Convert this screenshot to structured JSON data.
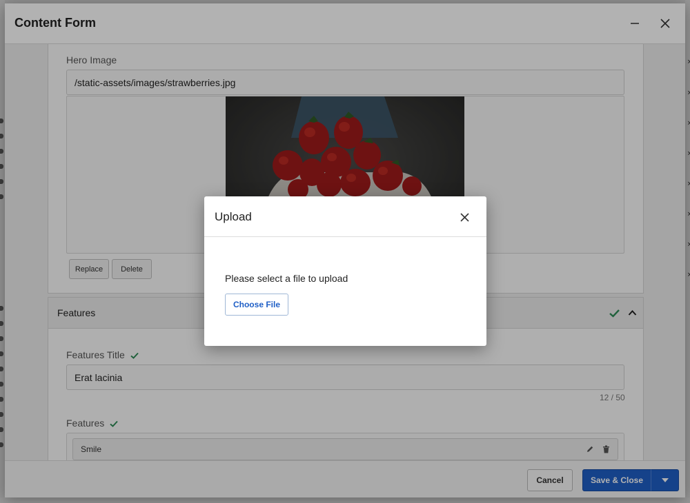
{
  "window": {
    "title": "Content Form"
  },
  "hero": {
    "label": "Hero Image",
    "path_value": "/static-assets/images/strawberries.jpg",
    "replace_label": "Replace",
    "delete_label": "Delete"
  },
  "features_section": {
    "title": "Features",
    "features_title_label": "Features Title",
    "features_title_value": "Erat lacinia",
    "features_title_counter": "12 / 50",
    "features_label": "Features",
    "items": [
      {
        "label": "Smile"
      }
    ]
  },
  "footer": {
    "cancel_label": "Cancel",
    "save_label": "Save & Close"
  },
  "upload_dialog": {
    "title": "Upload",
    "message": "Please select a file to upload",
    "choose_label": "Choose File"
  },
  "colors": {
    "accent": "#1f5fc6",
    "valid_check": "#2e8b57"
  }
}
